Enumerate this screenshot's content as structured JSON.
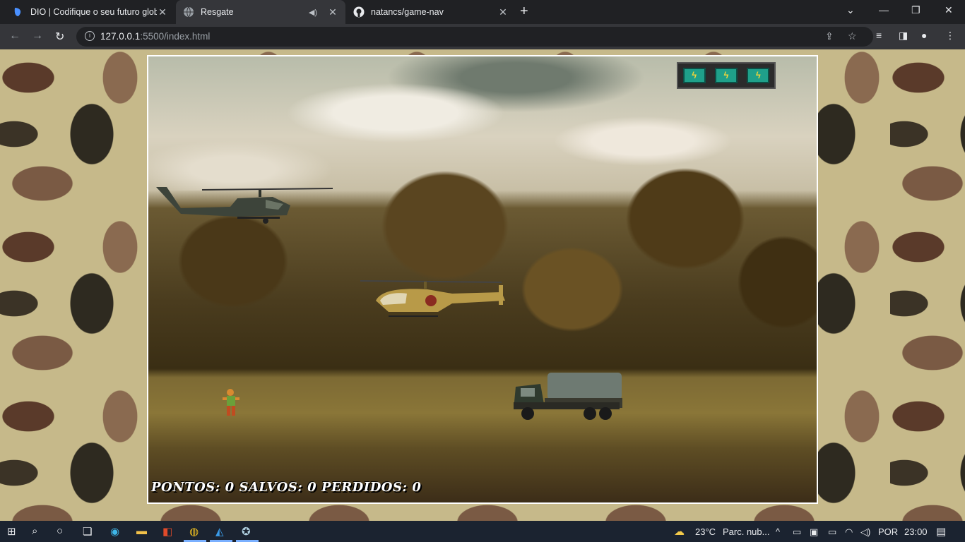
{
  "browser": {
    "tabs": [
      {
        "title": "DIO | Codifique o seu futuro glob",
        "active": false,
        "icon": "dio-icon"
      },
      {
        "title": "Resgate",
        "active": true,
        "icon": "globe-icon",
        "audio": true
      },
      {
        "title": "natancs/game-nav",
        "active": false,
        "icon": "github-icon"
      }
    ],
    "url_host": "127.0.0.1",
    "url_rest": ":5500/index.html"
  },
  "game": {
    "lives": 3,
    "score_text": "PONTOS: 0 SALVOS: 0 PERDIDOS: 0",
    "score": {
      "pontos": 0,
      "salvos": 0,
      "perdidos": 0
    }
  },
  "taskbar": {
    "weather_temp": "23°C",
    "weather_text": "Parc. nub...",
    "language": "POR",
    "time": "23:00"
  },
  "colors": {
    "tab_active": "#35363a",
    "chrome_bg": "#202124",
    "life_box": "#1fa08a",
    "taskbar": "#1b2330"
  }
}
